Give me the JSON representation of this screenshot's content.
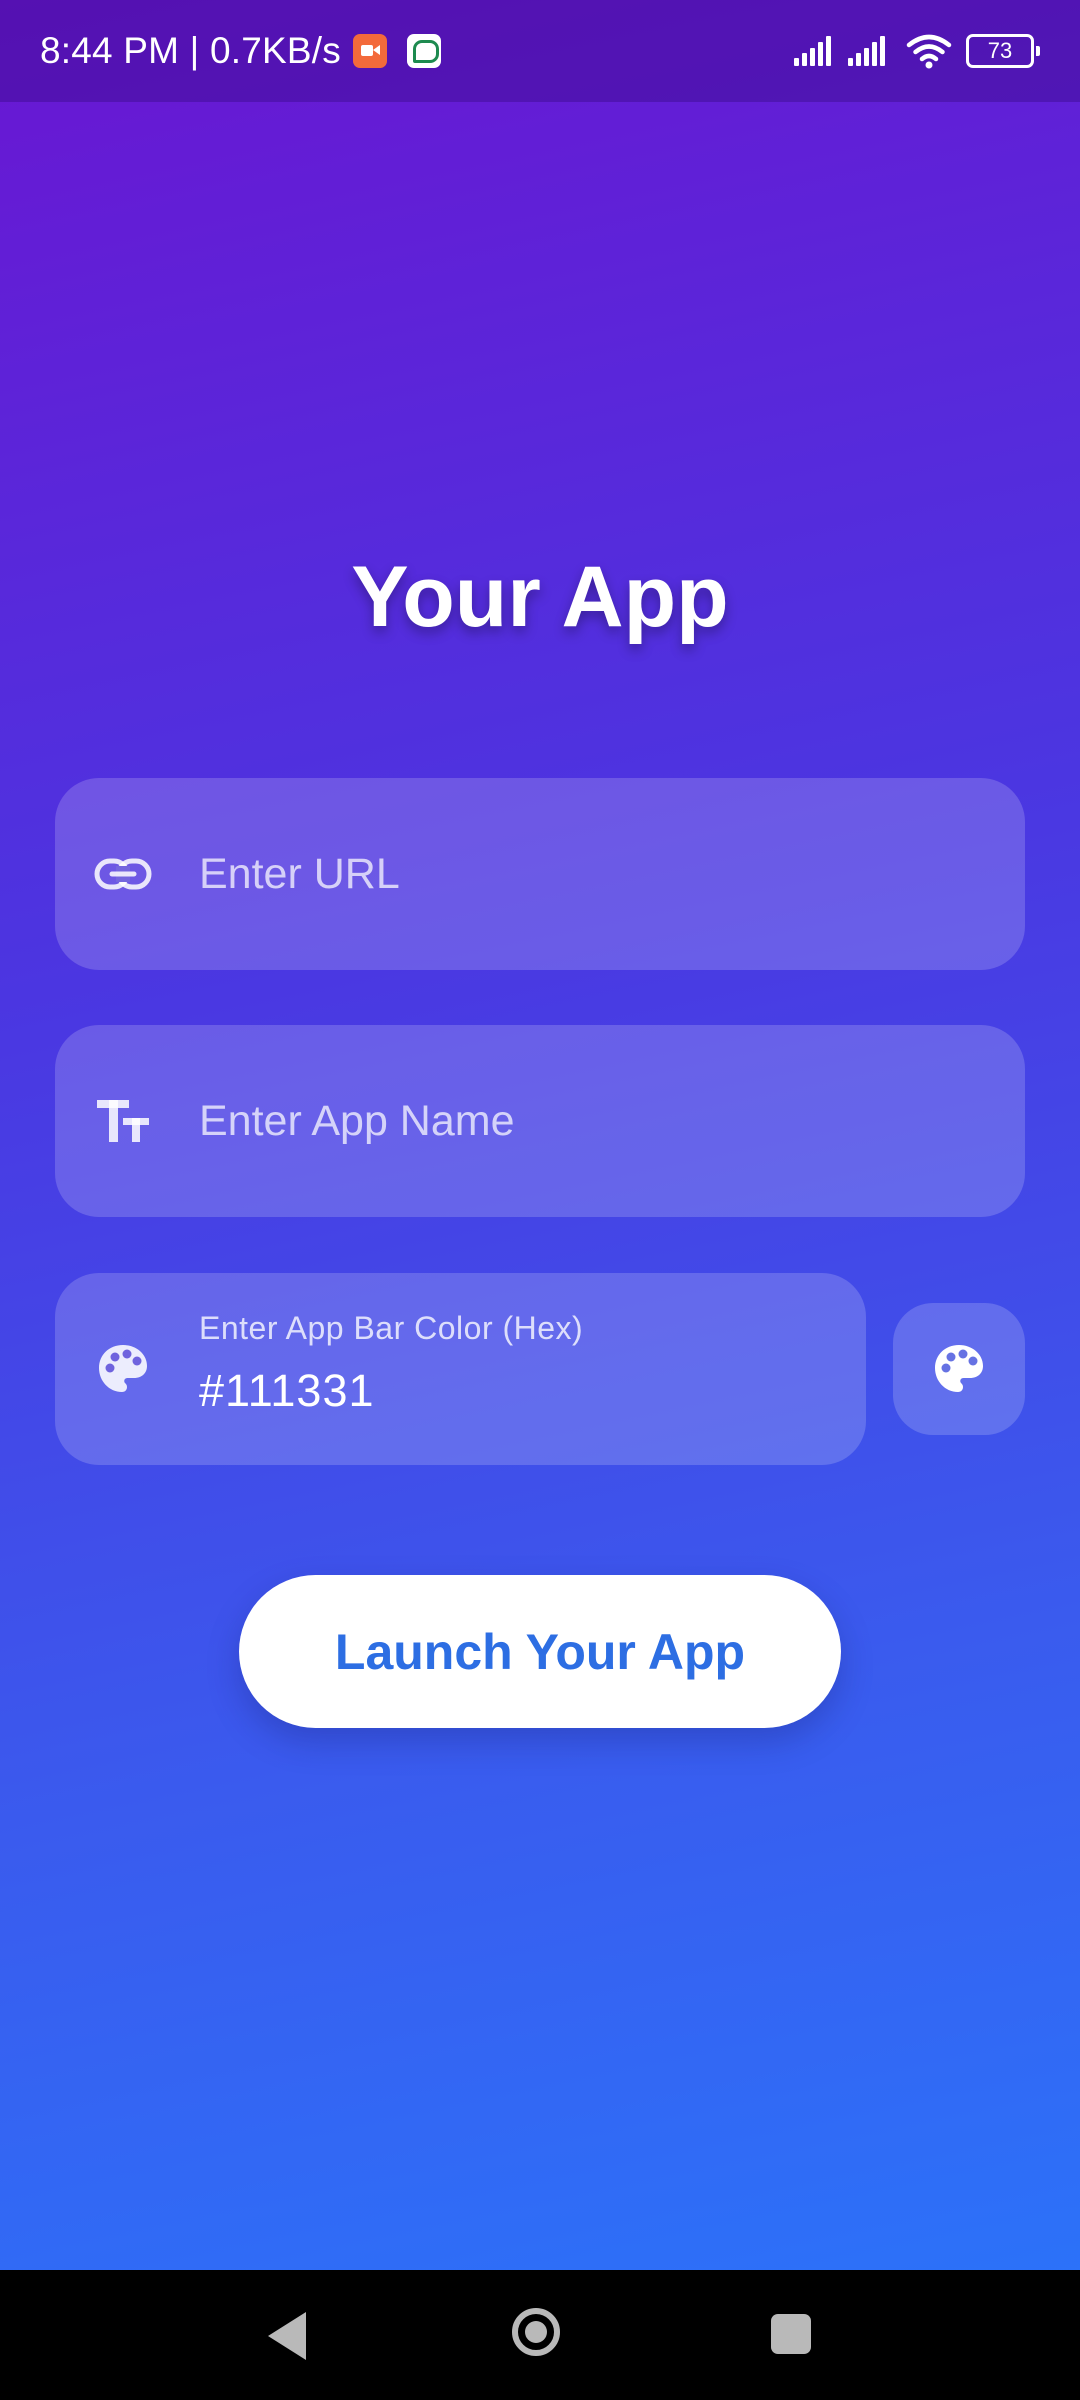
{
  "status_bar": {
    "time_speed": "8:44 PM | 0.7KB/s",
    "battery_level": "73",
    "notification_icons": [
      "video-call-icon",
      "chat-app-icon"
    ]
  },
  "app": {
    "title": "Your App"
  },
  "form": {
    "url": {
      "placeholder": "Enter URL",
      "value": "",
      "icon": "link-icon"
    },
    "app_name": {
      "placeholder": "Enter App Name",
      "value": "",
      "icon": "text-fields-icon"
    },
    "app_bar_color": {
      "label": "Enter App Bar Color (Hex)",
      "value": "#111331",
      "icon": "palette-icon"
    },
    "color_picker_icon": "palette-icon",
    "launch_button_label": "Launch Your App"
  },
  "colors": {
    "gradient_top": "#6a16d2",
    "gradient_bottom": "#2976fb",
    "launch_text": "#2d6ee3"
  }
}
